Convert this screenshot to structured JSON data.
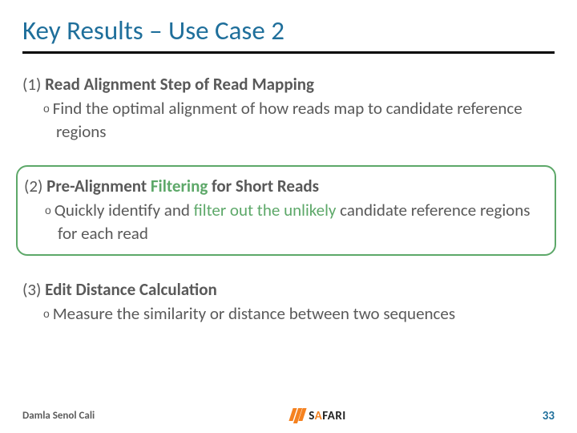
{
  "title": "Key Results – Use Case 2",
  "items": [
    {
      "num": "(1) ",
      "head": "Read Alignment Step of Read Mapping",
      "bullet": "o ",
      "text": "Find the optimal alignment of how reads map to candidate reference regions"
    },
    {
      "num": "(2) ",
      "head_pre": "Pre-Alignment ",
      "head_green": "Filtering",
      "head_post": " for Short Reads",
      "bullet": "o ",
      "text_a": "Quickly identify and ",
      "text_green": "filter out the unlikely",
      "text_b": " candidate reference regions for each read"
    },
    {
      "num": "(3) ",
      "head": "Edit Distance Calculation",
      "bullet": "o ",
      "text": "Measure the similarity or distance between two sequences"
    }
  ],
  "footer": {
    "author": "Damla Senol Cali",
    "logo": "SAFARI",
    "page": "33"
  }
}
